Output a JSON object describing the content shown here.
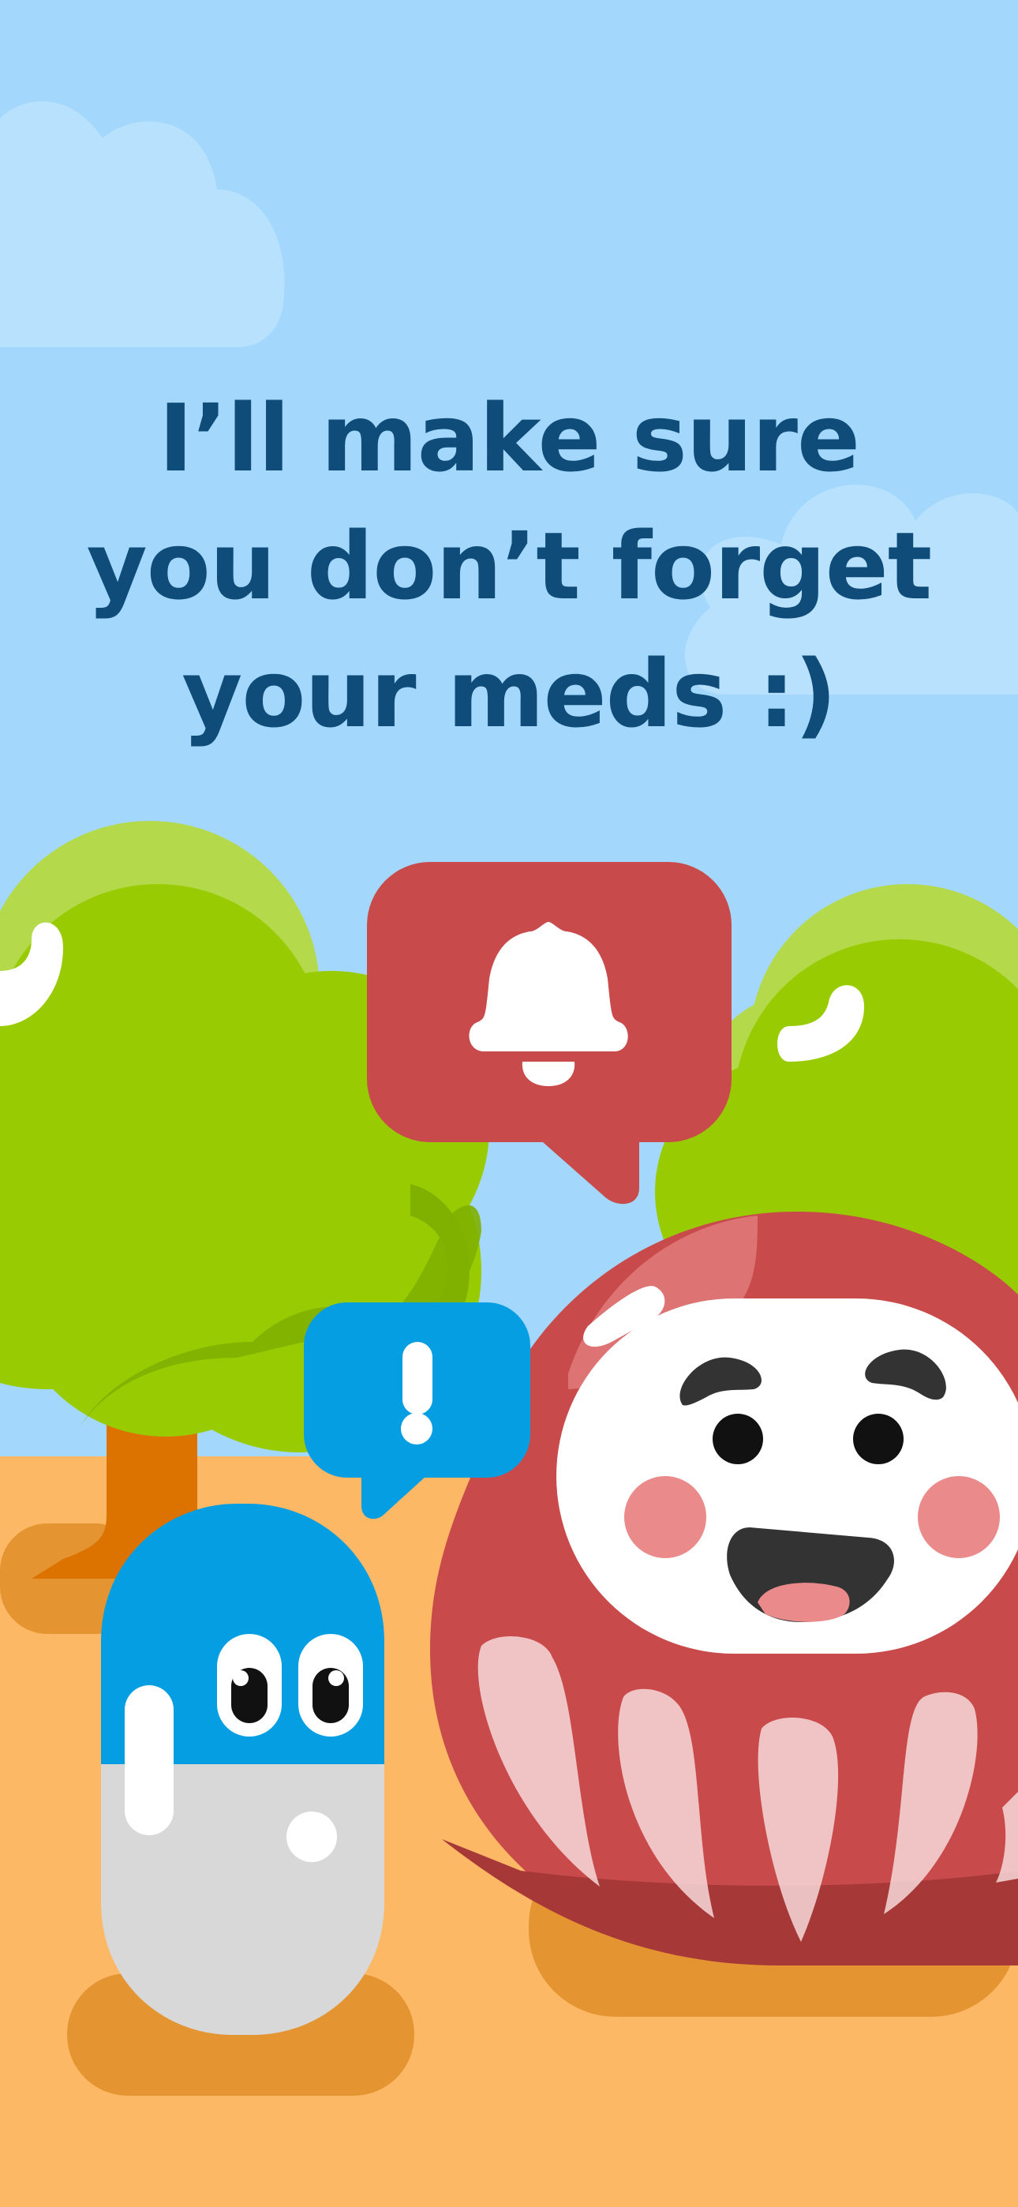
{
  "headline": {
    "lines": [
      "I’ll make sure",
      "you don’t forget",
      "your meds :)"
    ]
  },
  "colors": {
    "sky": "#a3d8fc",
    "ground": "#fcb864",
    "headline": "#0f4c7a",
    "bell_bubble": "#c94a4a",
    "alert_bubble": "#069ee3",
    "tree_green": "#99cb02",
    "daruma_red": "#c94a4a"
  },
  "icons": {
    "bell_bubble": "bell-icon",
    "alert_bubble": "exclamation-icon"
  }
}
